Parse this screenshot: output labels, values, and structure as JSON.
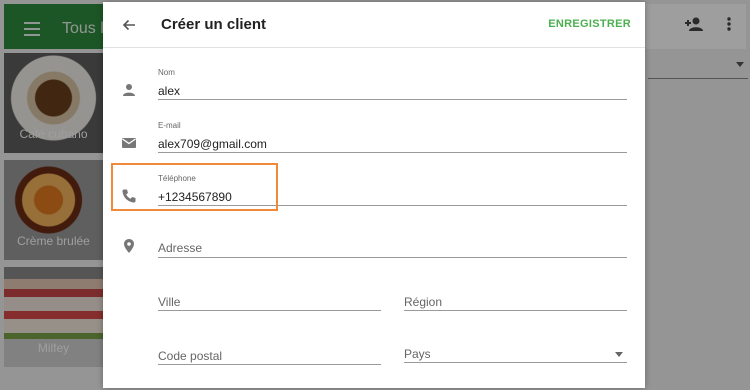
{
  "background": {
    "title": "Tous les produits",
    "tiles": [
      {
        "label": "Café cubano"
      },
      {
        "label": "Crème brulée"
      },
      {
        "label": "Milfey"
      }
    ]
  },
  "dialog": {
    "title": "Créer un client",
    "save_label": "ENREGISTRER",
    "fields": {
      "name": {
        "label": "Nom",
        "value": "alex"
      },
      "email": {
        "label": "E-mail",
        "value": "alex709@gmail.com"
      },
      "phone": {
        "label": "Téléphone",
        "value": "+1234567890"
      },
      "address": {
        "placeholder": "Adresse"
      },
      "city": {
        "placeholder": "Ville"
      },
      "region": {
        "placeholder": "Région"
      },
      "postal": {
        "placeholder": "Code postal"
      },
      "country": {
        "placeholder": "Pays"
      }
    }
  },
  "colors": {
    "accent": "#4caf50",
    "highlight": "#ee8a3a",
    "topbar": "#2e8b3e"
  }
}
